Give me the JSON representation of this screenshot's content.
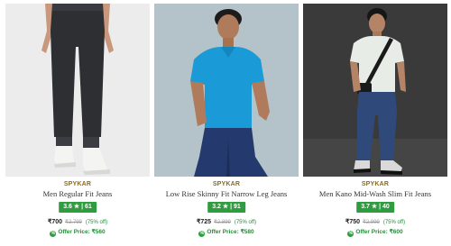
{
  "products": [
    {
      "brand": "SPYKAR",
      "title": "Men Regular Fit Jeans",
      "rating": "3.6 ★ | 61",
      "price": "₹700",
      "mrp": "₹2,799",
      "discount": "(75% off)",
      "offer": "Offer Price: ₹560"
    },
    {
      "brand": "SPYKAR",
      "title": "Low Rise Skinny Fit Narrow Leg Jeans",
      "rating": "3.2 ★ | 91",
      "price": "₹725",
      "mrp": "₹2,899",
      "discount": "(75% off)",
      "offer": "Offer Price: ₹580"
    },
    {
      "brand": "SPYKAR",
      "title": "Men Kano Mid-Wash Slim Fit Jeans",
      "rating": "3.7 ★ | 40",
      "price": "₹750",
      "mrp": "₹2,999",
      "discount": "(75% off)",
      "offer": "Offer Price: ₹600"
    }
  ],
  "colors": {
    "brand": "#8a6a1c",
    "rating_badge": "#2e9c3f",
    "discount": "#1e8f3a",
    "offer": "#2a8a3c"
  },
  "icons": {
    "offer": "offer-tag-icon"
  }
}
